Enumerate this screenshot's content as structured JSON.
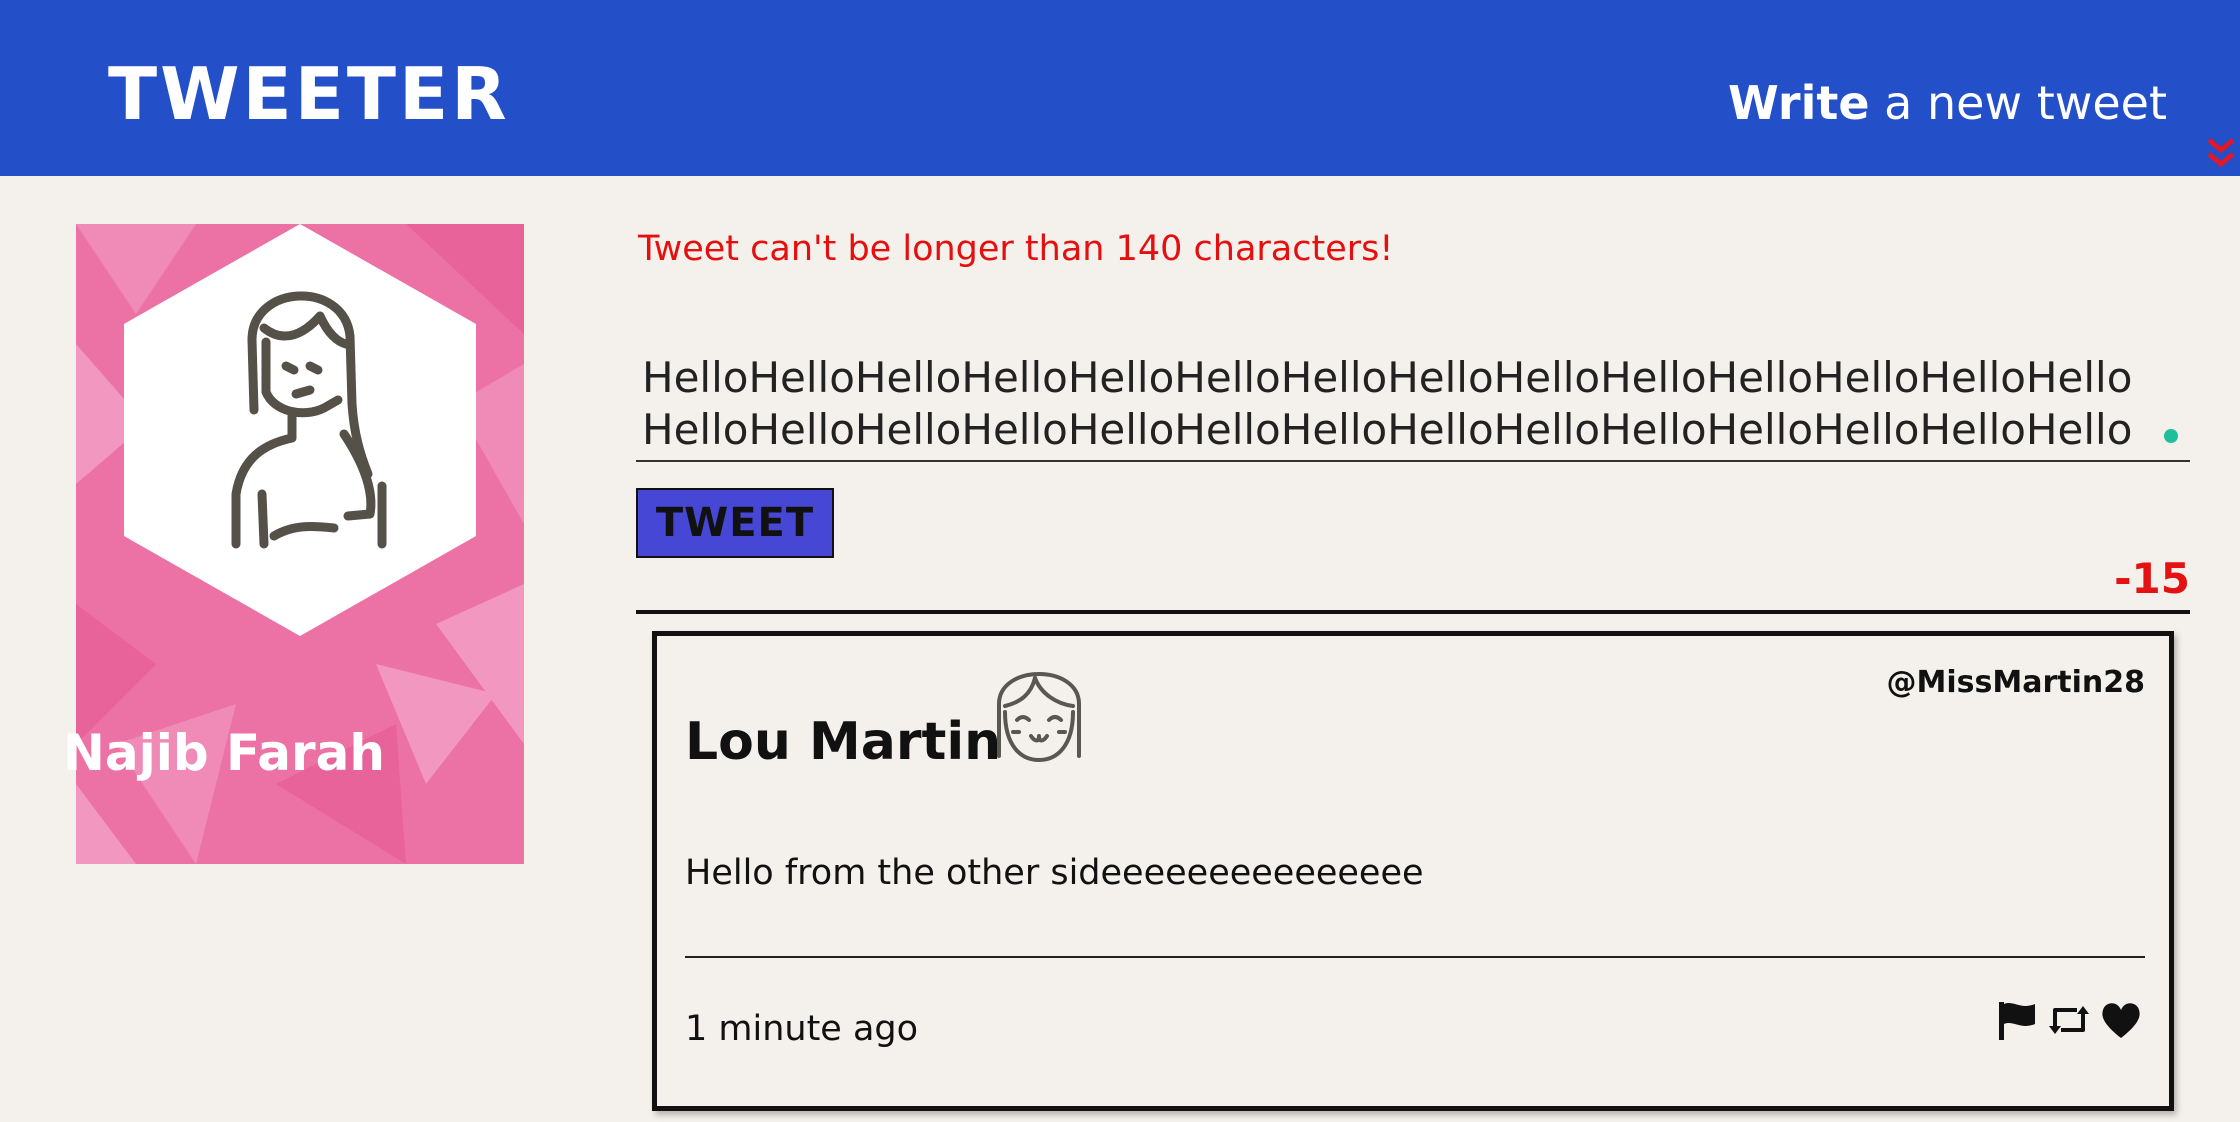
{
  "header": {
    "brand": "TWEETER",
    "compose_toggle_bold": "Write",
    "compose_toggle_rest": " a new tweet",
    "icons": {
      "compose": "double-chevron-down-icon"
    },
    "colors": {
      "bar": "#234fc8",
      "arrow": "#e0182a"
    }
  },
  "profile": {
    "name": "Najib Farah",
    "avatar": "woman-line-avatar",
    "background_color": "#ec72a6"
  },
  "compose": {
    "error": "Tweet can't be longer than 140 characters!",
    "text": "HelloHelloHelloHelloHelloHelloHelloHelloHelloHelloHelloHelloHelloHelloHelloHelloHelloHelloHelloHelloHelloHelloHelloHelloHelloHelloHelloHelloHelloHelloHello",
    "button_label": "TWEET",
    "counter": "-15",
    "colors": {
      "error": "#e40f0f",
      "button": "#4747d6",
      "counter": "#e41212"
    }
  },
  "tweets": [
    {
      "name": "Lou Martin",
      "handle": "@MissMartin28",
      "avatar": "smiling-girl-avatar",
      "content": "Hello from the other sideeeeeeeeeeeeeee",
      "time": "1 minute ago",
      "actions": [
        "flag-icon",
        "retweet-icon",
        "heart-icon"
      ]
    }
  ]
}
